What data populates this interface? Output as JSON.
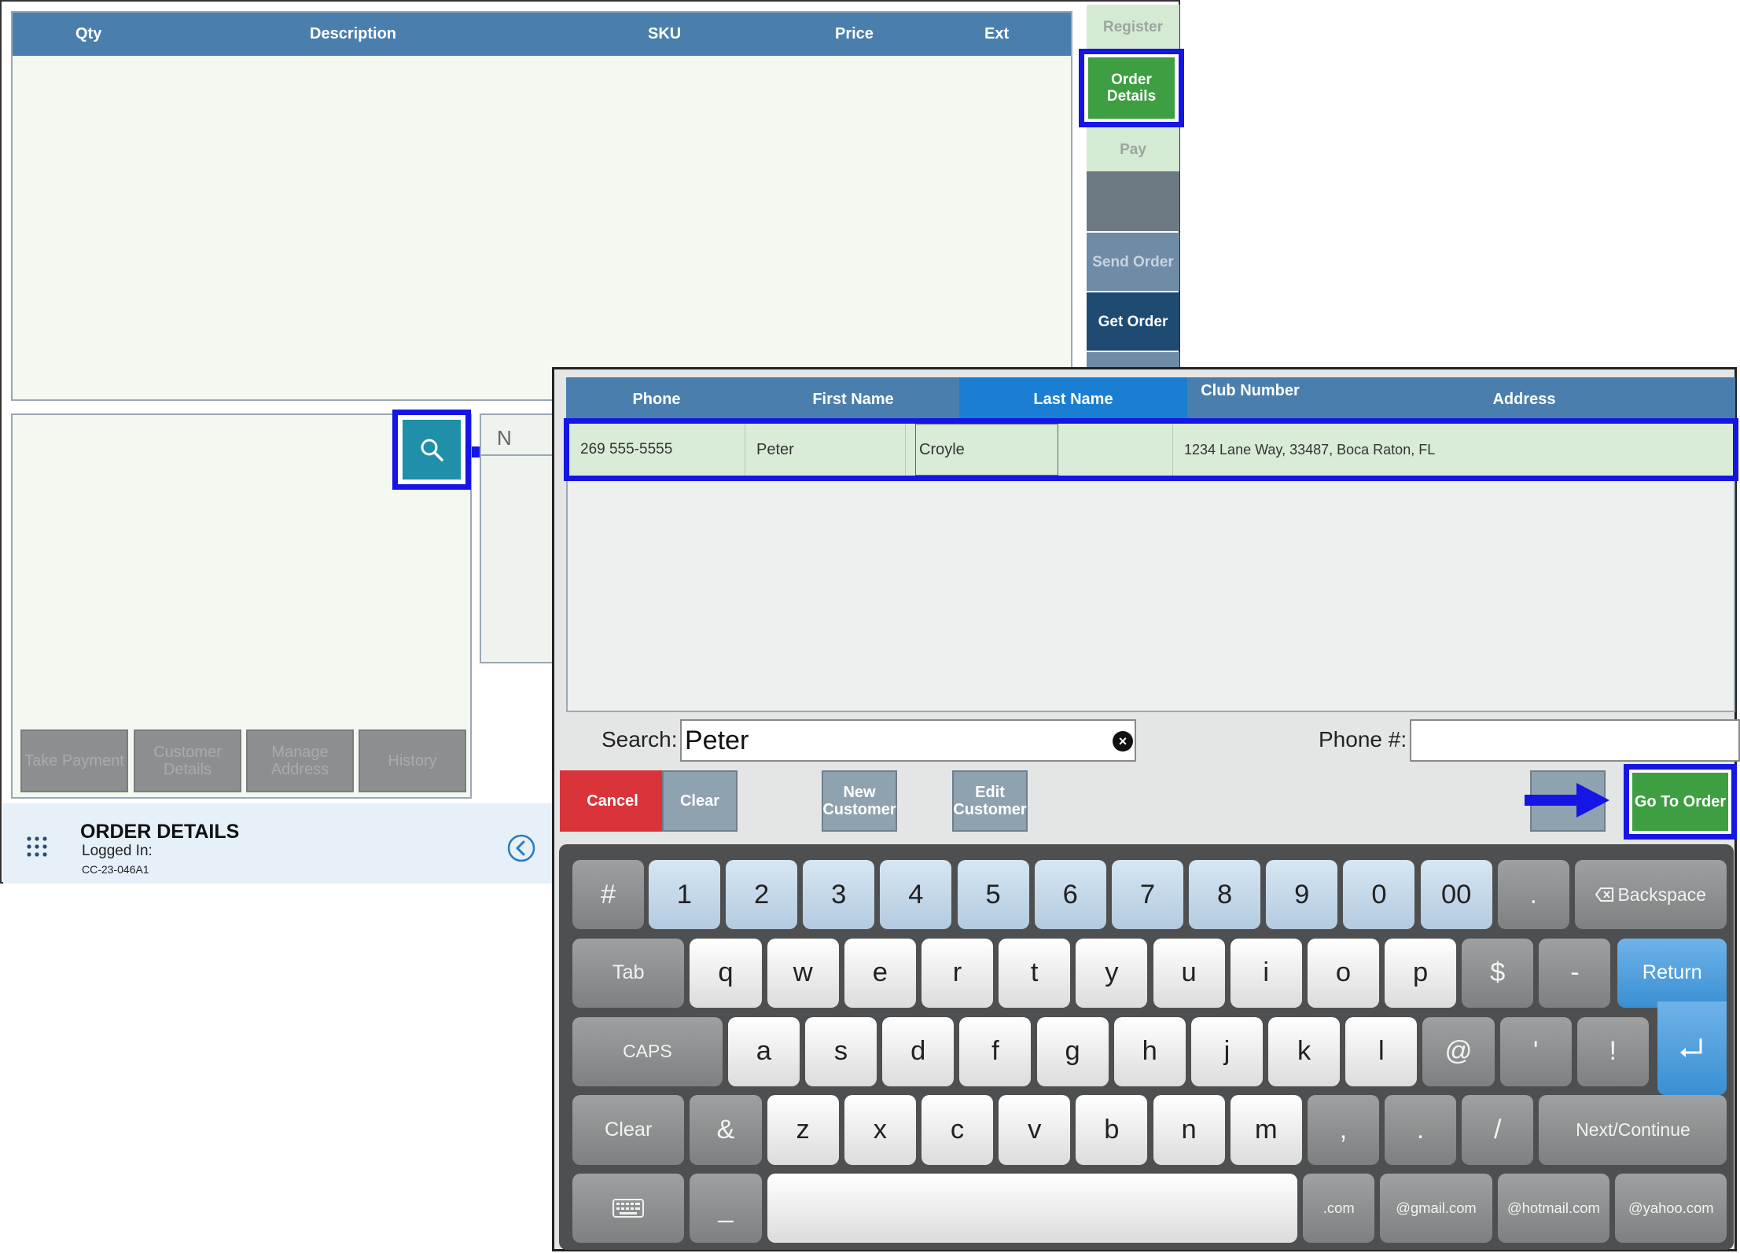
{
  "pos": {
    "grid_headers": [
      "Qty",
      "Description",
      "SKU",
      "Price",
      "Ext"
    ],
    "side_nav": {
      "register": "Register",
      "order_details": "Order Details",
      "pay": "Pay",
      "send_order": "Send Order",
      "get_order": "Get Order"
    },
    "notes_label": "N",
    "bottom_buttons": [
      "Take Payment",
      "Customer Details",
      "Manage Address",
      "History"
    ],
    "footer": {
      "title": "ORDER DETAILS",
      "logged_in": "Logged In:",
      "device_id": "CC-23-046A1"
    }
  },
  "dialog": {
    "headers": {
      "phone": "Phone",
      "first_name": "First Name",
      "last_name": "Last Name",
      "club_number": "Club Number",
      "address": "Address"
    },
    "row": {
      "phone": "269 555-5555",
      "first_name": "Peter",
      "last_name": "Croyle",
      "club_number": "",
      "address": "1234 Lane Way, 33487, Boca Raton, FL"
    },
    "search_label": "Search:",
    "search_value": "Peter",
    "phone_label": "Phone #:",
    "buttons": {
      "cancel": "Cancel",
      "clear": "Clear",
      "new_customer": "New Customer",
      "edit_customer": "Edit Customer",
      "go_to_order": "Go To Order"
    }
  },
  "keyboard": {
    "row1": [
      "#",
      "1",
      "2",
      "3",
      "4",
      "5",
      "6",
      "7",
      "8",
      "9",
      "0",
      "00",
      ".",
      "Backspace"
    ],
    "row2": [
      "Tab",
      "q",
      "w",
      "e",
      "r",
      "t",
      "y",
      "u",
      "i",
      "o",
      "p",
      "$",
      "-",
      "Return"
    ],
    "row3": [
      "CAPS",
      "a",
      "s",
      "d",
      "f",
      "g",
      "h",
      "j",
      "k",
      "l",
      "@",
      "'",
      "!"
    ],
    "row4": [
      "Clear",
      "&",
      "z",
      "x",
      "c",
      "v",
      "b",
      "n",
      "m",
      ",",
      ".",
      "/",
      "Next/Continue"
    ],
    "row5": [
      "_",
      ".com",
      "@gmail.com",
      "@hotmail.com",
      "@yahoo.com"
    ]
  },
  "colors": {
    "header_blue": "#4a7fad",
    "annotation_blue": "#1515e6",
    "go_green": "#3d9e42",
    "cancel_red": "#d9343a"
  },
  "icons": [
    "search-icon",
    "apps-grid-icon",
    "chevron-left-icon",
    "clear-x-icon",
    "keyboard-icon",
    "backspace-icon",
    "return-icon",
    "arrow-right-icon"
  ]
}
